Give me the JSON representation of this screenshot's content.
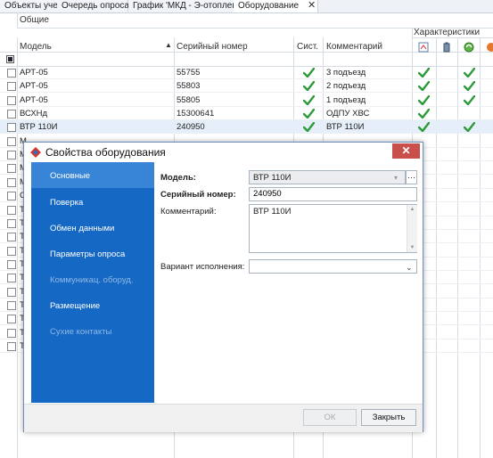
{
  "tabs": [
    {
      "label": "Объекты учета"
    },
    {
      "label": "Очередь опроса"
    },
    {
      "label": "График 'МКД - Э-отопление'"
    },
    {
      "label": "Оборудование",
      "close": "✕"
    }
  ],
  "grid": {
    "band_general": "Общие",
    "band_characteristics": "Характеристики",
    "columns": {
      "model": "Модель",
      "serial": "Серийный номер",
      "system": "Сист.",
      "comment": "Комментарий"
    },
    "rows": [
      {
        "model": "АРТ-05",
        "serial": "55755",
        "system": true,
        "comment": "3 подъезд",
        "c1": true,
        "c3": true
      },
      {
        "model": "АРТ-05",
        "serial": "55803",
        "system": true,
        "comment": "2 подъезд",
        "c1": true,
        "c3": true
      },
      {
        "model": "АРТ-05",
        "serial": "55805",
        "system": true,
        "comment": "1 подъезд",
        "c1": true,
        "c3": true
      },
      {
        "model": "ВСХНд",
        "serial": "15300641",
        "system": true,
        "comment": "ОДПУ ХВС",
        "c1": true,
        "c3": false
      },
      {
        "model": "ВТР 110И",
        "serial": "240950",
        "system": true,
        "comment": "ВТР 110И",
        "c1": true,
        "c3": true
      },
      {
        "model": "М"
      },
      {
        "model": "М"
      },
      {
        "model": "М"
      },
      {
        "model": "М"
      },
      {
        "model": "С"
      },
      {
        "model": "Т"
      },
      {
        "model": "Т"
      },
      {
        "model": "Т"
      },
      {
        "model": "Т"
      },
      {
        "model": "Т"
      },
      {
        "model": "Т"
      },
      {
        "model": "Т"
      },
      {
        "model": "Т"
      },
      {
        "model": "Т"
      },
      {
        "model": "Т"
      },
      {
        "model": "Т"
      }
    ]
  },
  "dialog": {
    "title": "Свойства оборудования",
    "close": "✕",
    "nav": [
      {
        "label": "Основные",
        "selected": true,
        "enabled": true
      },
      {
        "label": "Поверка",
        "enabled": true
      },
      {
        "label": "Обмен данными",
        "enabled": true
      },
      {
        "label": "Параметры опроса",
        "enabled": true
      },
      {
        "label": "Коммуникац. оборуд.",
        "enabled": false
      },
      {
        "label": "Размещение",
        "enabled": true
      },
      {
        "label": "Сухие контакты",
        "enabled": false
      }
    ],
    "form": {
      "model_label": "Модель:",
      "model_value": "ВТР 110И",
      "model_more": "…",
      "serial_label": "Серийный номер:",
      "serial_value": "240950",
      "comment_label": "Комментарий:",
      "comment_value": "ВТР 110И",
      "variant_label": "Вариант исполнения:",
      "variant_value": ""
    },
    "buttons": {
      "ok": "ОК",
      "close": "Закрыть"
    }
  },
  "colors": {
    "nav_bg": "#1568c4",
    "nav_selected": "#3884d6",
    "check": "#2e9a3a",
    "close_btn": "#c9504a"
  }
}
